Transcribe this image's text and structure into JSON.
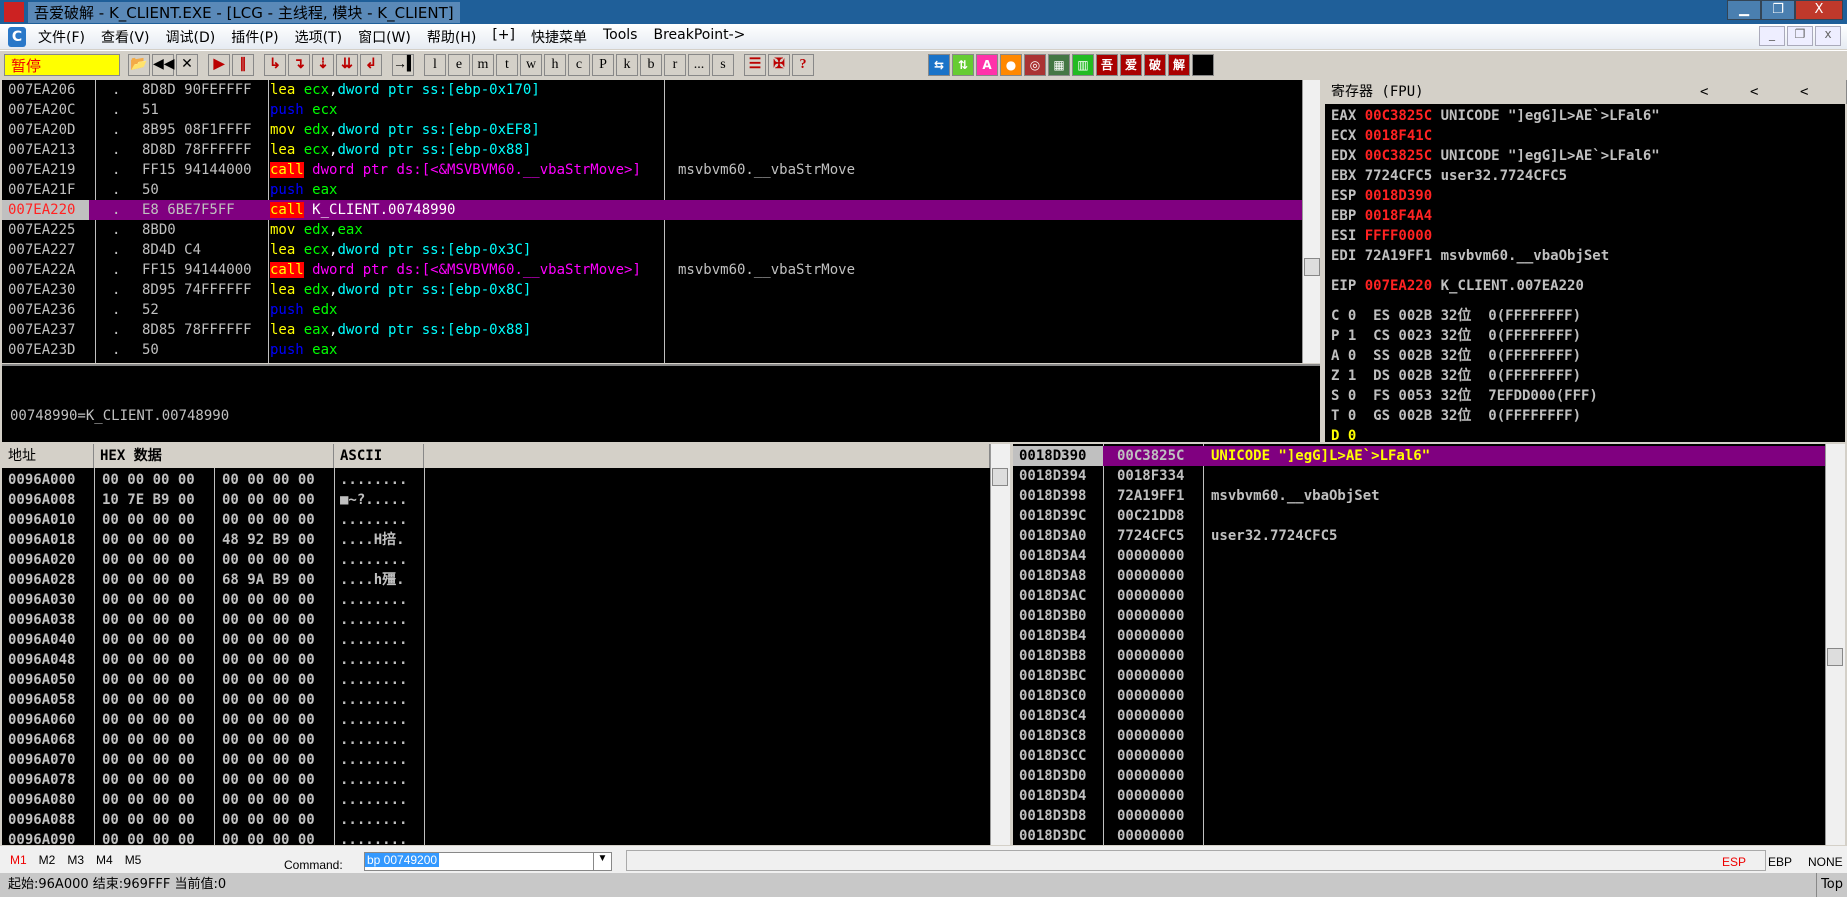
{
  "window": {
    "title": "吾爱破解 - K_CLIENT.EXE - [LCG - 主线程, 模块 - K_CLIENT]",
    "logo_text": "吾爱破解",
    "minimize": "▁",
    "restore": "❐",
    "close": "X"
  },
  "menu": {
    "items": [
      "文件(F)",
      "查看(V)",
      "调试(D)",
      "插件(P)",
      "选项(T)",
      "窗口(W)",
      "帮助(H)",
      "[+]",
      "快捷菜单",
      "Tools",
      "BreakPoint->"
    ],
    "mdi": [
      "_",
      "❐",
      "x"
    ]
  },
  "toolbar": {
    "status": "暂停",
    "buttons": [
      {
        "name": "open",
        "g": "📂"
      },
      {
        "name": "restart",
        "g": "◀◀"
      },
      {
        "name": "close",
        "g": "✕"
      }
    ],
    "run": [
      {
        "name": "run",
        "g": "▶"
      },
      {
        "name": "pause",
        "g": "∥"
      }
    ],
    "step": [
      {
        "name": "step-into",
        "g": "↳"
      },
      {
        "name": "step-over",
        "g": "↴"
      },
      {
        "name": "trace-into",
        "g": "⇣"
      },
      {
        "name": "trace-over",
        "g": "⇊"
      },
      {
        "name": "execute-till-return",
        "g": "↲"
      }
    ],
    "goto": {
      "name": "execute-till-user-code",
      "g": "→▍"
    },
    "windows": [
      "l",
      "e",
      "m",
      "t",
      "w",
      "h",
      "c",
      "P",
      "k",
      "b",
      "r",
      "...",
      "s"
    ],
    "extra": [
      {
        "name": "list",
        "g": "☰"
      },
      {
        "name": "options",
        "g": "✠"
      },
      {
        "name": "help",
        "g": "?"
      }
    ],
    "plugins": [
      {
        "name": "swap",
        "g": "⇆",
        "color": "#1a73c8"
      },
      {
        "name": "updown",
        "g": "⇅",
        "color": "#6c3"
      },
      {
        "name": "a",
        "g": "A",
        "color": "#f3a"
      },
      {
        "name": "record",
        "g": "●",
        "color": "#f80"
      },
      {
        "name": "target",
        "g": "◎",
        "color": "#a33"
      },
      {
        "name": "binary",
        "g": "▦",
        "color": "#474"
      },
      {
        "name": "panel",
        "g": "▥",
        "color": "#2b2"
      },
      {
        "name": "wu",
        "g": "吾",
        "color": "#a00"
      },
      {
        "name": "ai",
        "g": "爱",
        "color": "#a00"
      },
      {
        "name": "po",
        "g": "破",
        "color": "#a00"
      },
      {
        "name": "jie",
        "g": "解",
        "color": "#a00"
      },
      {
        "name": "black",
        "g": "",
        "color": "#000"
      }
    ]
  },
  "disasm": {
    "rows": [
      {
        "addr": "007EA206",
        "dot": ".",
        "hex": "8D8D 90FEFFFF",
        "op": "lea",
        "args": [
          [
            "g",
            "ecx"
          ],
          [
            "w",
            ","
          ],
          [
            "cy",
            "dword ptr ss:[ebp-0x170]"
          ]
        ],
        "comment": ""
      },
      {
        "addr": "007EA20C",
        "dot": ".",
        "hex": "51",
        "op": "push",
        "args": [
          [
            "g",
            "ecx"
          ]
        ],
        "comment": ""
      },
      {
        "addr": "007EA20D",
        "dot": ".",
        "hex": "8B95 08F1FFFF",
        "op": "mov",
        "args": [
          [
            "g",
            "edx"
          ],
          [
            "w",
            ","
          ],
          [
            "cy",
            "dword ptr ss:[ebp-0xEF8]"
          ]
        ],
        "comment": ""
      },
      {
        "addr": "007EA213",
        "dot": ".",
        "hex": "8D8D 78FFFFFF",
        "op": "lea",
        "args": [
          [
            "g",
            "ecx"
          ],
          [
            "w",
            ","
          ],
          [
            "cy",
            "dword ptr ss:[ebp-0x88]"
          ]
        ],
        "comment": ""
      },
      {
        "addr": "007EA219",
        "dot": ".",
        "hex": "FF15 94144000",
        "op": "call",
        "args": [
          [
            "m",
            "dword ptr ds:[<&MSVBVM60.__vbaStrMove>]"
          ]
        ],
        "comment": "msvbvm60.__vbaStrMove"
      },
      {
        "addr": "007EA21F",
        "dot": ".",
        "hex": "50",
        "op": "push",
        "args": [
          [
            "g",
            "eax"
          ]
        ],
        "comment": ""
      },
      {
        "addr": "007EA220",
        "dot": ".",
        "hex": "E8 6BE7F5FF",
        "op": "call",
        "args": [
          [
            "w",
            "K_CLIENT.00748990"
          ]
        ],
        "comment": "",
        "current": true
      },
      {
        "addr": "007EA225",
        "dot": ".",
        "hex": "8BD0",
        "op": "mov",
        "args": [
          [
            "g",
            "edx"
          ],
          [
            "w",
            ","
          ],
          [
            "g",
            "eax"
          ]
        ],
        "comment": ""
      },
      {
        "addr": "007EA227",
        "dot": ".",
        "hex": "8D4D C4",
        "op": "lea",
        "args": [
          [
            "g",
            "ecx"
          ],
          [
            "w",
            ","
          ],
          [
            "cy",
            "dword ptr ss:[ebp-0x3C]"
          ]
        ],
        "comment": ""
      },
      {
        "addr": "007EA22A",
        "dot": ".",
        "hex": "FF15 94144000",
        "op": "call",
        "args": [
          [
            "m",
            "dword ptr ds:[<&MSVBVM60.__vbaStrMove>]"
          ]
        ],
        "comment": "msvbvm60.__vbaStrMove"
      },
      {
        "addr": "007EA230",
        "dot": ".",
        "hex": "8D95 74FFFFFF",
        "op": "lea",
        "args": [
          [
            "g",
            "edx"
          ],
          [
            "w",
            ","
          ],
          [
            "cy",
            "dword ptr ss:[ebp-0x8C]"
          ]
        ],
        "comment": ""
      },
      {
        "addr": "007EA236",
        "dot": ".",
        "hex": "52",
        "op": "push",
        "args": [
          [
            "g",
            "edx"
          ]
        ],
        "comment": ""
      },
      {
        "addr": "007EA237",
        "dot": ".",
        "hex": "8D85 78FFFFFF",
        "op": "lea",
        "args": [
          [
            "g",
            "eax"
          ],
          [
            "w",
            ","
          ],
          [
            "cy",
            "dword ptr ss:[ebp-0x88]"
          ]
        ],
        "comment": ""
      },
      {
        "addr": "007EA23D",
        "dot": ".",
        "hex": "50",
        "op": "push",
        "args": [
          [
            "g",
            "eax"
          ]
        ],
        "comment": ""
      }
    ],
    "info": "00748990=K_CLIENT.00748990"
  },
  "registers": {
    "title": "寄存器 (FPU)",
    "arrows": [
      "<",
      "<",
      "<"
    ],
    "gp": [
      {
        "n": "EAX",
        "v": "00C3825C",
        "chg": true,
        "c": "UNICODE \"]egG]L>AE`>LFal6\""
      },
      {
        "n": "ECX",
        "v": "0018F41C",
        "chg": true,
        "c": ""
      },
      {
        "n": "EDX",
        "v": "00C3825C",
        "chg": true,
        "c": "UNICODE \"]egG]L>AE`>LFal6\""
      },
      {
        "n": "EBX",
        "v": "7724CFC5",
        "chg": false,
        "c": "user32.7724CFC5"
      },
      {
        "n": "ESP",
        "v": "0018D390",
        "chg": true,
        "c": ""
      },
      {
        "n": "EBP",
        "v": "0018F4A4",
        "chg": true,
        "c": ""
      },
      {
        "n": "ESI",
        "v": "FFFF0000",
        "chg": true,
        "c": ""
      },
      {
        "n": "EDI",
        "v": "72A19FF1",
        "chg": false,
        "c": "msvbvm60.__vbaObjSet"
      }
    ],
    "eip": {
      "n": "EIP",
      "v": "007EA220",
      "c": "K_CLIENT.007EA220"
    },
    "flags": [
      "C 0  ES 002B 32位  0(FFFFFFFF)",
      "P 1  CS 0023 32位  0(FFFFFFFF)",
      "A 0  SS 002B 32位  0(FFFFFFFF)",
      "Z 1  DS 002B 32位  0(FFFFFFFF)",
      "S 0  FS 0053 32位  7EFDD000(FFF)",
      "T 0  GS 002B 32位  0(FFFFFFFF)",
      "D 0"
    ]
  },
  "dump": {
    "headers": [
      "地址",
      "HEX 数据",
      "ASCII"
    ],
    "rows": [
      [
        "0096A000",
        "00 00 00 00",
        "00 00 00 00",
        "........"
      ],
      [
        "0096A008",
        "10 7E B9 00",
        "00 00 00 00",
        "■~?....."
      ],
      [
        "0096A010",
        "00 00 00 00",
        "00 00 00 00",
        "........"
      ],
      [
        "0096A018",
        "00 00 00 00",
        "48 92 B9 00",
        "....H掊."
      ],
      [
        "0096A020",
        "00 00 00 00",
        "00 00 00 00",
        "........"
      ],
      [
        "0096A028",
        "00 00 00 00",
        "68 9A B9 00",
        "....h殭."
      ],
      [
        "0096A030",
        "00 00 00 00",
        "00 00 00 00",
        "........"
      ],
      [
        "0096A038",
        "00 00 00 00",
        "00 00 00 00",
        "........"
      ],
      [
        "0096A040",
        "00 00 00 00",
        "00 00 00 00",
        "........"
      ],
      [
        "0096A048",
        "00 00 00 00",
        "00 00 00 00",
        "........"
      ],
      [
        "0096A050",
        "00 00 00 00",
        "00 00 00 00",
        "........"
      ],
      [
        "0096A058",
        "00 00 00 00",
        "00 00 00 00",
        "........"
      ],
      [
        "0096A060",
        "00 00 00 00",
        "00 00 00 00",
        "........"
      ],
      [
        "0096A068",
        "00 00 00 00",
        "00 00 00 00",
        "........"
      ],
      [
        "0096A070",
        "00 00 00 00",
        "00 00 00 00",
        "........"
      ],
      [
        "0096A078",
        "00 00 00 00",
        "00 00 00 00",
        "........"
      ],
      [
        "0096A080",
        "00 00 00 00",
        "00 00 00 00",
        "........"
      ],
      [
        "0096A088",
        "00 00 00 00",
        "00 00 00 00",
        "........"
      ],
      [
        "0096A090",
        "00 00 00 00",
        "00 00 00 00",
        "........"
      ]
    ]
  },
  "stack": {
    "rows": [
      [
        "0018D390",
        "00C3825C",
        "UNICODE \"]egG]L>AE`>LFal6\""
      ],
      [
        "0018D394",
        "0018F334",
        ""
      ],
      [
        "0018D398",
        "72A19FF1",
        "msvbvm60.__vbaObjSet"
      ],
      [
        "0018D39C",
        "00C21DD8",
        ""
      ],
      [
        "0018D3A0",
        "7724CFC5",
        "user32.7724CFC5"
      ],
      [
        "0018D3A4",
        "00000000",
        ""
      ],
      [
        "0018D3A8",
        "00000000",
        ""
      ],
      [
        "0018D3AC",
        "00000000",
        ""
      ],
      [
        "0018D3B0",
        "00000000",
        ""
      ],
      [
        "0018D3B4",
        "00000000",
        ""
      ],
      [
        "0018D3B8",
        "00000000",
        ""
      ],
      [
        "0018D3BC",
        "00000000",
        ""
      ],
      [
        "0018D3C0",
        "00000000",
        ""
      ],
      [
        "0018D3C4",
        "00000000",
        ""
      ],
      [
        "0018D3C8",
        "00000000",
        ""
      ],
      [
        "0018D3CC",
        "00000000",
        ""
      ],
      [
        "0018D3D0",
        "00000000",
        ""
      ],
      [
        "0018D3D4",
        "00000000",
        ""
      ],
      [
        "0018D3D8",
        "00000000",
        ""
      ],
      [
        "0018D3DC",
        "00000000",
        ""
      ]
    ]
  },
  "command": {
    "tabs": [
      "M1",
      "M2",
      "M3",
      "M4",
      "M5"
    ],
    "label": "Command:",
    "value": "bp 00749200",
    "modes": [
      "ESP",
      "EBP",
      "NONE"
    ]
  },
  "status": {
    "text": "起始:96A000 结束:969FFF 当前值:0",
    "right": "Top"
  }
}
